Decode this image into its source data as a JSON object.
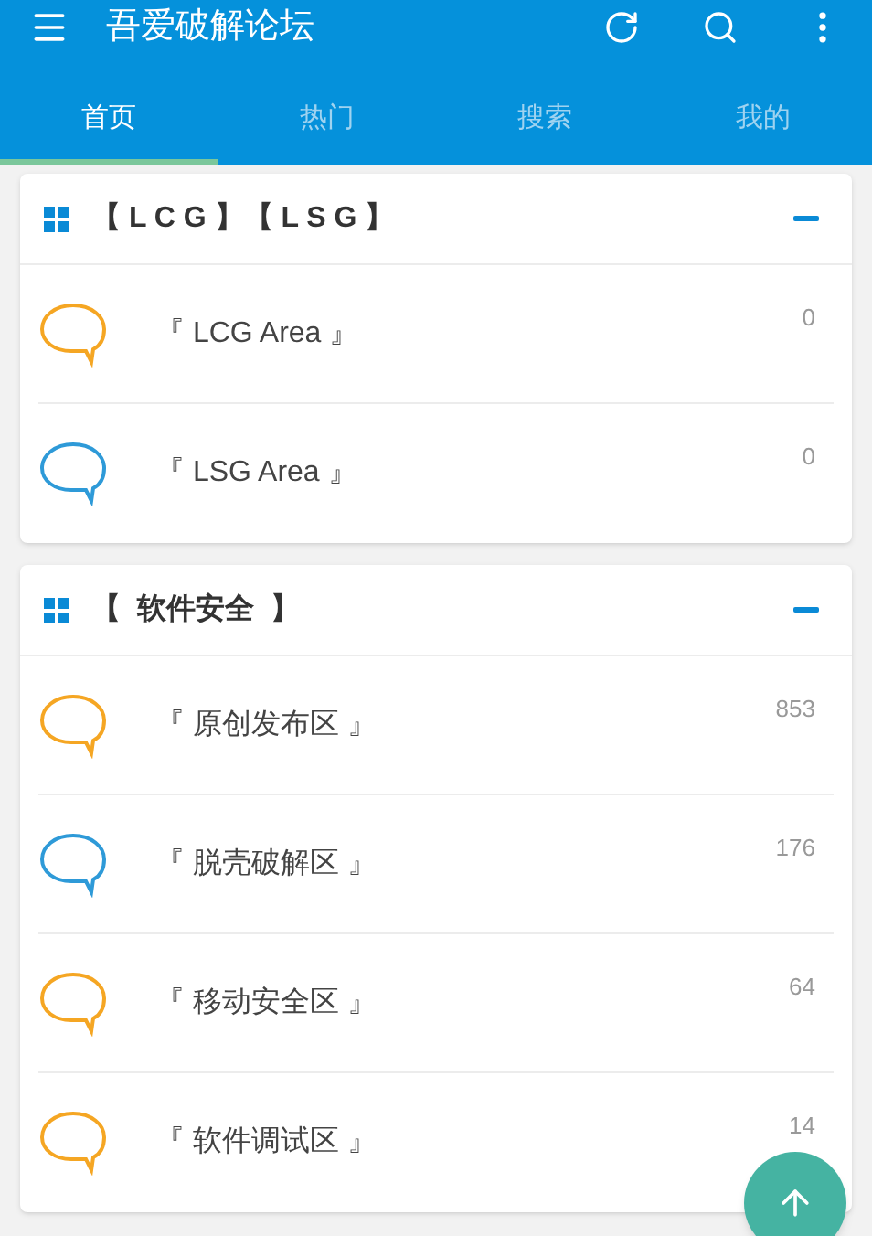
{
  "app_bar": {
    "title": "吾爱破解论坛"
  },
  "tabs": [
    {
      "label": "首页",
      "selected": true
    },
    {
      "label": "热门",
      "selected": false
    },
    {
      "label": "搜索",
      "selected": false
    },
    {
      "label": "我的",
      "selected": false
    }
  ],
  "sections": [
    {
      "title": "【 L C G 】【 L S G 】",
      "expanded": true,
      "forums": [
        {
          "name": "『 LCG Area 』",
          "count": "0",
          "color": "#f5a623"
        },
        {
          "name": "『 LSG Area 』",
          "count": "0",
          "color": "#2e9ad8"
        }
      ]
    },
    {
      "title": "【  软件安全  】",
      "expanded": true,
      "forums": [
        {
          "name": "『 原创发布区 』",
          "count": "853",
          "color": "#f5a623"
        },
        {
          "name": "『 脱壳破解区 』",
          "count": "176",
          "color": "#2e9ad8"
        },
        {
          "name": "『 移动安全区 』",
          "count": "64",
          "color": "#f5a623"
        },
        {
          "name": "『 软件调试区 』",
          "count": "14",
          "color": "#f5a623"
        }
      ]
    }
  ]
}
